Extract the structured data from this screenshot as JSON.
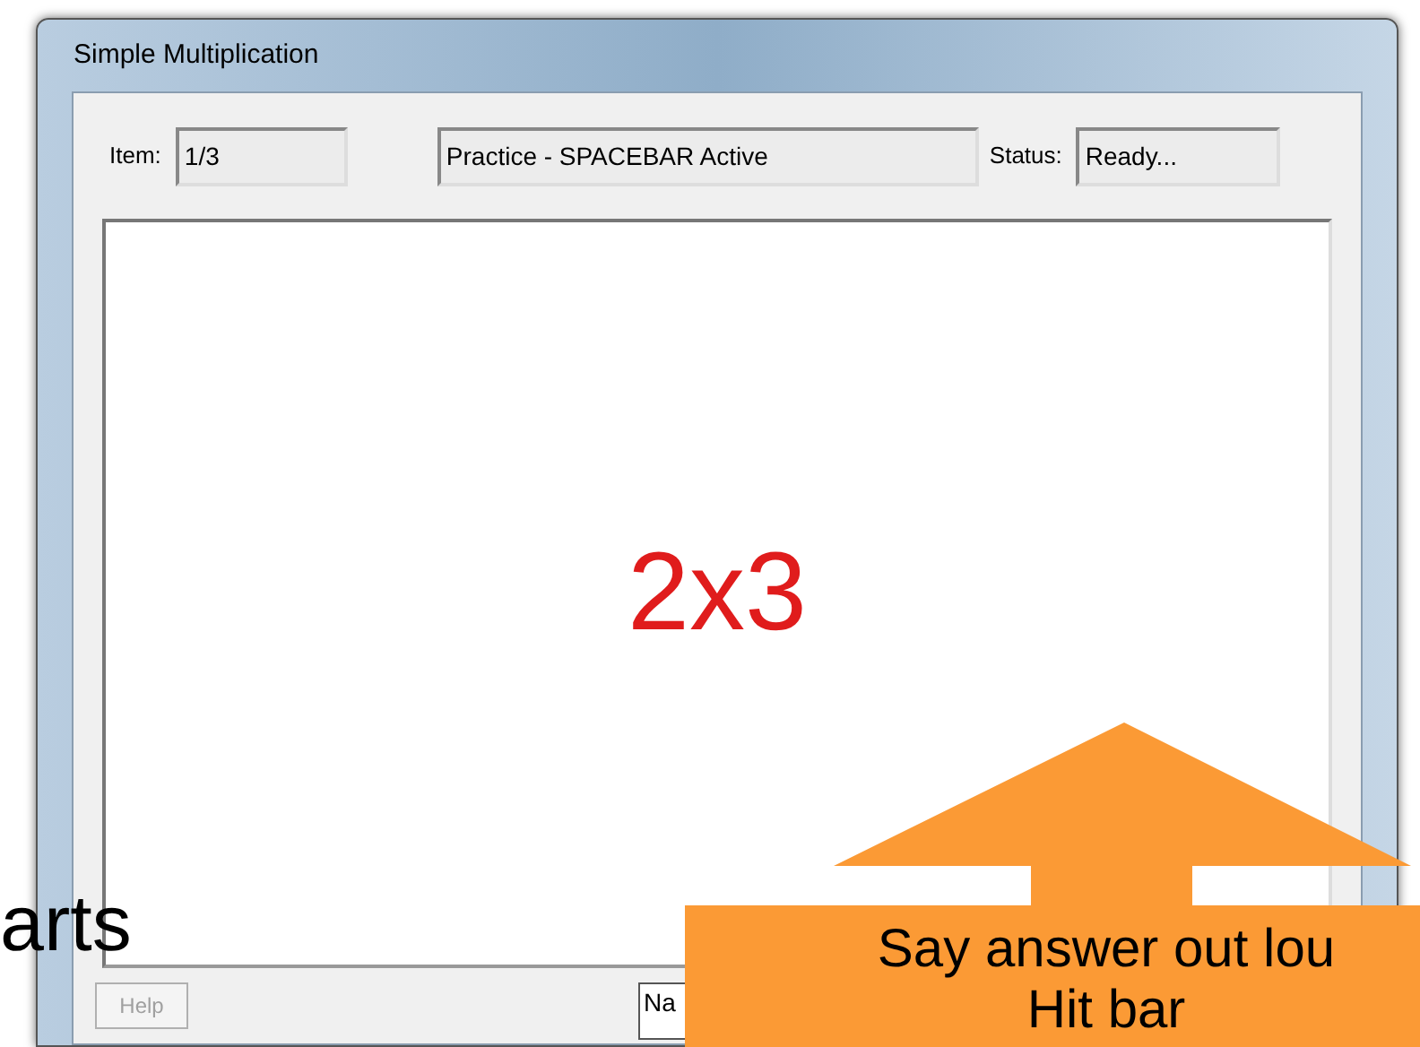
{
  "window": {
    "title": "Simple Multiplication"
  },
  "fields": [
    {
      "label": "Item:",
      "value": "1/3"
    },
    {
      "value": "Practice - SPACEBAR Active"
    },
    {
      "label": "Status:",
      "value": "Ready..."
    }
  ],
  "problem": "2x3",
  "help_button": {
    "label": "Help",
    "disabled": true
  },
  "name_field": {
    "value": "Na"
  },
  "slide_text": "arts",
  "callout": {
    "lines": [
      "Say answer out lou",
      "Hit bar"
    ]
  }
}
